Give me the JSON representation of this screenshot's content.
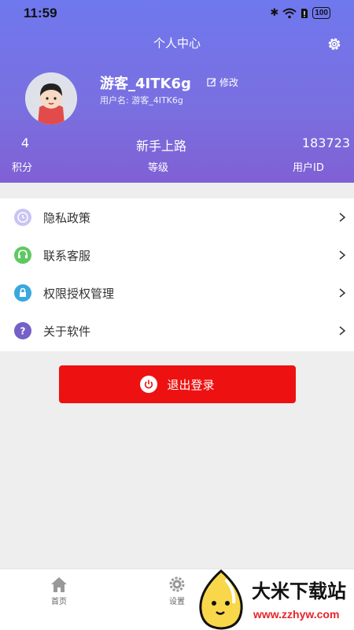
{
  "status_bar": {
    "time": "11:59",
    "battery": "100"
  },
  "nav": {
    "title": "个人中心"
  },
  "profile": {
    "name": "游客_4ITK6g",
    "edit_label": "修改",
    "username_line": "用户名: 游客_4ITK6g"
  },
  "stats": [
    {
      "value": "4",
      "label": "积分"
    },
    {
      "value": "新手上路",
      "label": "等级"
    },
    {
      "value": "183723",
      "label": "用户ID"
    }
  ],
  "menu": {
    "items": [
      {
        "label": "隐私政策",
        "icon": "privacy-icon",
        "color": "#b8b3ee"
      },
      {
        "label": "联系客服",
        "icon": "customer-service-icon",
        "color": "#5fc863"
      },
      {
        "label": "权限授权管理",
        "icon": "lock-icon",
        "color": "#3aa7e0"
      },
      {
        "label": "关于软件",
        "icon": "question-icon",
        "color": "#7560c8"
      }
    ]
  },
  "logout": {
    "label": "退出登录"
  },
  "tabbar": {
    "tabs": [
      {
        "label": "首页"
      },
      {
        "label": "设置"
      }
    ]
  },
  "watermark": {
    "title": "大米下载站",
    "url": "www.zzhyw.com"
  },
  "colors": {
    "header_top": "#6f78ee",
    "header_bottom": "#8060d4",
    "logout": "#ee1111",
    "background": "#eeeeee"
  }
}
